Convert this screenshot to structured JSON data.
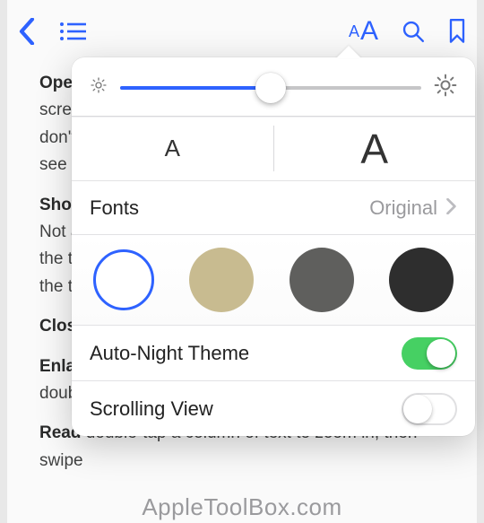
{
  "toolbar": {
    "back": "back",
    "contents": "contents",
    "appearance": "appearance",
    "search": "search",
    "bookmark": "bookmark"
  },
  "body": {
    "p1_bold": "Open",
    "p1_rest": " screen don't see o",
    "p2_bold": "Show",
    "p2_rest": " Not a the th the ta",
    "p3_bold": "Close",
    "p4_bold": "Enlar",
    "p4_rest": " doubl",
    "p5_bold": "Read",
    "p5_rest": " double-tap a column of text to zoom in, then swipe"
  },
  "popover": {
    "brightness_pct": 50,
    "font_small": "A",
    "font_large": "A",
    "fonts_label": "Fonts",
    "fonts_value": "Original",
    "themes": [
      {
        "name": "white",
        "color": "#ffffff",
        "selected": true
      },
      {
        "name": "sepia",
        "color": "#c8bb90",
        "selected": false
      },
      {
        "name": "gray",
        "color": "#5f5f5d",
        "selected": false
      },
      {
        "name": "night",
        "color": "#2e2e2e",
        "selected": false
      }
    ],
    "auto_night_label": "Auto-Night Theme",
    "auto_night_on": true,
    "scrolling_label": "Scrolling View",
    "scrolling_on": false
  },
  "watermark": "AppleToolBox.com"
}
